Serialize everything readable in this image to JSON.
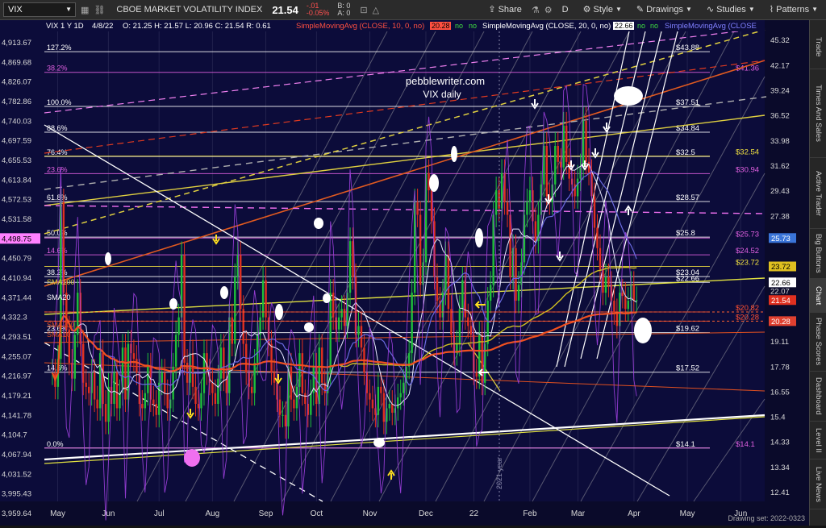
{
  "toolbar": {
    "symbol": "VIX",
    "description": "CBOE MARKET VOLATILITY INDEX",
    "last": "21.54",
    "change": "-.01",
    "change_pct": "-0.05%",
    "bid": "B: 0",
    "ask": "A: 0",
    "share": "Share",
    "period": "D",
    "style": "Style",
    "drawings": "Drawings",
    "studies": "Studies",
    "patterns": "Patterns"
  },
  "sidebar": [
    "Trade",
    "Times And Sales",
    "Active Trader",
    "Big Buttons",
    "Chart",
    "Phase Scores",
    "Dashboard",
    "Level II",
    "Live News"
  ],
  "chart_data": {
    "type": "candlestick",
    "header": {
      "title": "VIX 1 Y 1D",
      "date": "4/8/22",
      "ohlc": "O: 21.25  H: 21.57  L: 20.96  C: 21.54  R: 0.61",
      "study1": "SimpleMovingAvg (CLOSE, 10, 0, no)",
      "study1_value": "20.28",
      "study2": "SimpleMovingAvg (CLOSE, 20, 0, no)",
      "study2_value": "22.66",
      "study3": "SimpleMovingAvg (CLOSE",
      "flag": "no"
    },
    "watermark": [
      "pebblewriter.com",
      "VIX daily"
    ],
    "x_labels": [
      "May",
      "Jun",
      "Jul",
      "Aug",
      "Sep",
      "Oct",
      "Nov",
      "Dec",
      "22",
      "Feb",
      "Mar",
      "Apr",
      "May",
      "Jun"
    ],
    "x_positions": [
      0.5,
      2.4,
      4.3,
      6.3,
      8.3,
      10.2,
      12.2,
      14.3,
      16.1,
      18.2,
      20.0,
      22.1,
      24.1,
      26.1
    ],
    "year_marker": "2021 year",
    "right_axis": [
      "45.32",
      "42.17",
      "39.24",
      "36.52",
      "33.98",
      "31.62",
      "29.43",
      "27.38",
      "25.73",
      "23.72",
      "22.66",
      "22.07",
      "21.54",
      "20.28",
      "19.11",
      "17.78",
      "16.55",
      "15.4",
      "14.33",
      "13.34",
      "12.41"
    ],
    "right_axis_values": [
      45.32,
      42.17,
      39.24,
      36.52,
      33.98,
      31.62,
      29.43,
      27.38,
      25.73,
      23.72,
      22.66,
      22.07,
      21.54,
      20.28,
      19.11,
      17.78,
      16.55,
      15.4,
      14.33,
      13.34,
      12.41
    ],
    "badges": [
      {
        "label": "25.73",
        "value": 25.73,
        "color": "#3a74d8"
      },
      {
        "label": "23.72",
        "value": 23.72,
        "color": "#e0c020"
      },
      {
        "label": "22.66",
        "value": 22.66,
        "color": "#ffffff"
      },
      {
        "label": "21.54",
        "value": 21.54,
        "color": "#e03020"
      },
      {
        "label": "20.28",
        "value": 20.28,
        "color": "#e04030"
      }
    ],
    "left_axis": [
      "4,913.67",
      "4,869.68",
      "4,826.07",
      "4,782.86",
      "4,740.03",
      "4,697.59",
      "4,655.53",
      "4,613.84",
      "4,572.53",
      "4,531.58",
      "4,498.75",
      "4,450.79",
      "4,410.94",
      "4,371.44",
      "4,332.3",
      "4,293.51",
      "4,255.07",
      "4,216.97",
      "4,179.21",
      "4,141.78",
      "4,104.7",
      "4,067.94",
      "4,031.52",
      "3,995.43",
      "3,959.64"
    ],
    "fib_levels": [
      {
        "pct": "127.2%",
        "value": 43.88,
        "right": "$43.88",
        "color": "#ffffff"
      },
      {
        "pct": "38.2%",
        "value": 41.36,
        "right": "$41.36",
        "color": "#e060e0"
      },
      {
        "pct": "100.0%",
        "value": 37.51,
        "right": "$37.51",
        "color": "#ffffff"
      },
      {
        "pct": "88.6%",
        "value": 34.84,
        "right": "$34.84",
        "color": "#ffffff"
      },
      {
        "pct": "76.4%",
        "value": 32.5,
        "right": "$32.5",
        "color": "#ffffff"
      },
      {
        "pct": "",
        "value": 32.54,
        "right": "$32.54",
        "color": "#f0e040"
      },
      {
        "pct": "23.6%",
        "value": 30.94,
        "right": "$30.94",
        "color": "#e060e0"
      },
      {
        "pct": "61.8%",
        "value": 28.57,
        "right": "$28.57",
        "color": "#ffffff"
      },
      {
        "pct": "50.0%",
        "value": 25.8,
        "right": "$25.8",
        "color": "#ffffff"
      },
      {
        "pct": "",
        "value": 25.73,
        "right": "$25.73",
        "color": "#e060e0"
      },
      {
        "pct": "14.6%",
        "value": 24.52,
        "right": "$24.52",
        "color": "#e060e0"
      },
      {
        "pct": "",
        "value": 23.72,
        "right": "$23.72",
        "color": "#f0e040"
      },
      {
        "pct": "38.2%",
        "value": 23.04,
        "right": "$23.04",
        "color": "#ffffff"
      },
      {
        "pct": "",
        "value": 22.66,
        "right": "$22.66",
        "color": "#ffffff"
      },
      {
        "pct": "",
        "value": 20.82,
        "right": "$20.82",
        "color": "#ff5030"
      },
      {
        "pct": "",
        "value": 20.28,
        "right": "$20.28",
        "color": "#ff5030"
      },
      {
        "pct": "23.6%",
        "value": 19.62,
        "right": "$19.62",
        "color": "#ffffff"
      },
      {
        "pct": "14.6%",
        "value": 17.52,
        "right": "$17.52",
        "color": "#ffffff"
      },
      {
        "pct": "0.0%",
        "value": 14.1,
        "right": "$14.1",
        "color": "#ffffff"
      },
      {
        "pct": "",
        "value": 14.1,
        "right": "$14.1",
        "color": "#e060e0"
      }
    ],
    "ma_labels": [
      "SMA100",
      "SMA20",
      "SMA200",
      "SMA10"
    ],
    "status": "Drawing set: 2022-0323",
    "close_series": [
      17.5,
      16.8,
      18.2,
      28.5,
      22.0,
      19.8,
      18.0,
      17.2,
      19.5,
      22.0,
      19.0,
      17.0,
      16.8,
      16.5,
      17.5,
      16.2,
      15.8,
      18.5,
      16.0,
      15.2,
      16.8,
      16.0,
      17.5,
      15.8,
      16.5,
      18.8,
      16.2,
      19.0,
      18.5,
      18.2,
      17.5,
      16.0,
      15.8,
      16.5,
      17.8,
      16.2,
      16.0,
      15.5,
      17.0,
      17.5,
      16.5,
      15.8,
      16.2,
      17.8,
      19.5,
      20.5,
      24.5,
      18.0,
      17.0,
      18.5,
      16.8,
      16.0,
      15.8,
      16.5,
      18.5,
      17.5,
      17.0,
      16.5,
      16.0,
      17.2,
      18.8,
      17.2,
      16.5,
      20.5,
      19.0,
      23.0,
      24.5,
      21.0,
      19.0,
      17.5,
      16.8,
      16.5,
      18.0,
      19.5,
      20.5,
      22.8,
      20.5,
      19.0,
      17.5,
      17.0,
      16.2,
      15.5,
      15.5,
      15.0,
      17.8,
      16.2,
      15.8,
      16.8,
      18.5,
      16.5,
      16.0,
      15.5,
      16.5,
      17.8,
      16.0,
      18.8,
      17.0,
      16.5,
      17.5,
      22.0,
      20.5,
      19.8,
      20.5,
      21.0,
      20.0,
      22.0,
      25.5,
      23.0,
      19.5,
      20.0,
      18.8,
      17.5,
      16.5,
      16.2,
      15.8,
      15.5,
      16.8,
      16.5,
      15.2,
      15.8,
      16.0,
      15.6,
      15.8,
      16.3,
      16.5,
      17.0,
      17.8,
      18.5,
      22.0,
      28.5,
      27.5,
      22.5,
      24.0,
      31.0,
      29.5,
      27.0,
      23.0,
      21.5,
      20.5,
      22.0,
      24.5,
      21.0,
      19.5,
      18.5,
      19.0,
      21.0,
      22.8,
      20.5,
      20.0,
      19.5,
      17.5,
      17.3,
      19.5,
      17.0,
      19.0,
      21.5,
      22.5,
      27.5,
      29.5,
      28.0,
      31.0,
      28.5,
      27.5,
      23.0,
      25.0,
      21.5,
      22.5,
      24.0,
      27.5,
      28.5,
      29.5,
      27.0,
      25.5,
      27.5,
      30.0,
      33.5,
      29.0,
      28.5,
      30.0,
      33.5,
      32.0,
      31.5,
      35.5,
      32.0,
      30.5,
      30.0,
      29.0,
      30.5,
      31.5,
      36.0,
      32.0,
      31.0,
      29.0,
      26.5,
      25.0,
      23.5,
      22.0,
      23.0,
      22.5,
      21.5,
      20.8,
      20.0,
      22.0,
      21.8,
      21.0,
      21.5,
      22.5,
      21.5,
      21.54
    ]
  }
}
